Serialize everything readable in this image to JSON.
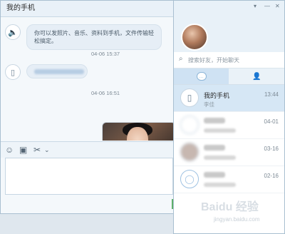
{
  "chat": {
    "title": "我的手机",
    "controls": {
      "minimize": "—",
      "maximize": "□",
      "close": "✕"
    },
    "messages": [
      {
        "text": "你可以发照片、音乐、资料到手机，文件传输轻松搞定。"
      },
      {
        "time": "04-06 15:37"
      },
      {
        "time": "04-06 16:51"
      }
    ],
    "toolbar": {
      "emoji": "☺",
      "file": "▣",
      "scissors": "✂",
      "dropdown": "⌄"
    }
  },
  "panel": {
    "controls": {
      "menu": "▾",
      "minimize": "—",
      "close": "✕"
    },
    "search_placeholder": "搜索好友，开始聊天",
    "tabs": {
      "chat": "…",
      "contacts": "👤"
    },
    "items": [
      {
        "name": "我的手机",
        "sub": "李佳",
        "date": "13:44"
      },
      {
        "name": "",
        "sub": "",
        "date": "04-01"
      },
      {
        "name": "",
        "sub": "",
        "date": "03-16"
      },
      {
        "name": "",
        "sub": "",
        "date": "02-16"
      }
    ]
  },
  "watermark": {
    "text": "Baidu 经验",
    "sub": "jingyan.baidu.com"
  }
}
